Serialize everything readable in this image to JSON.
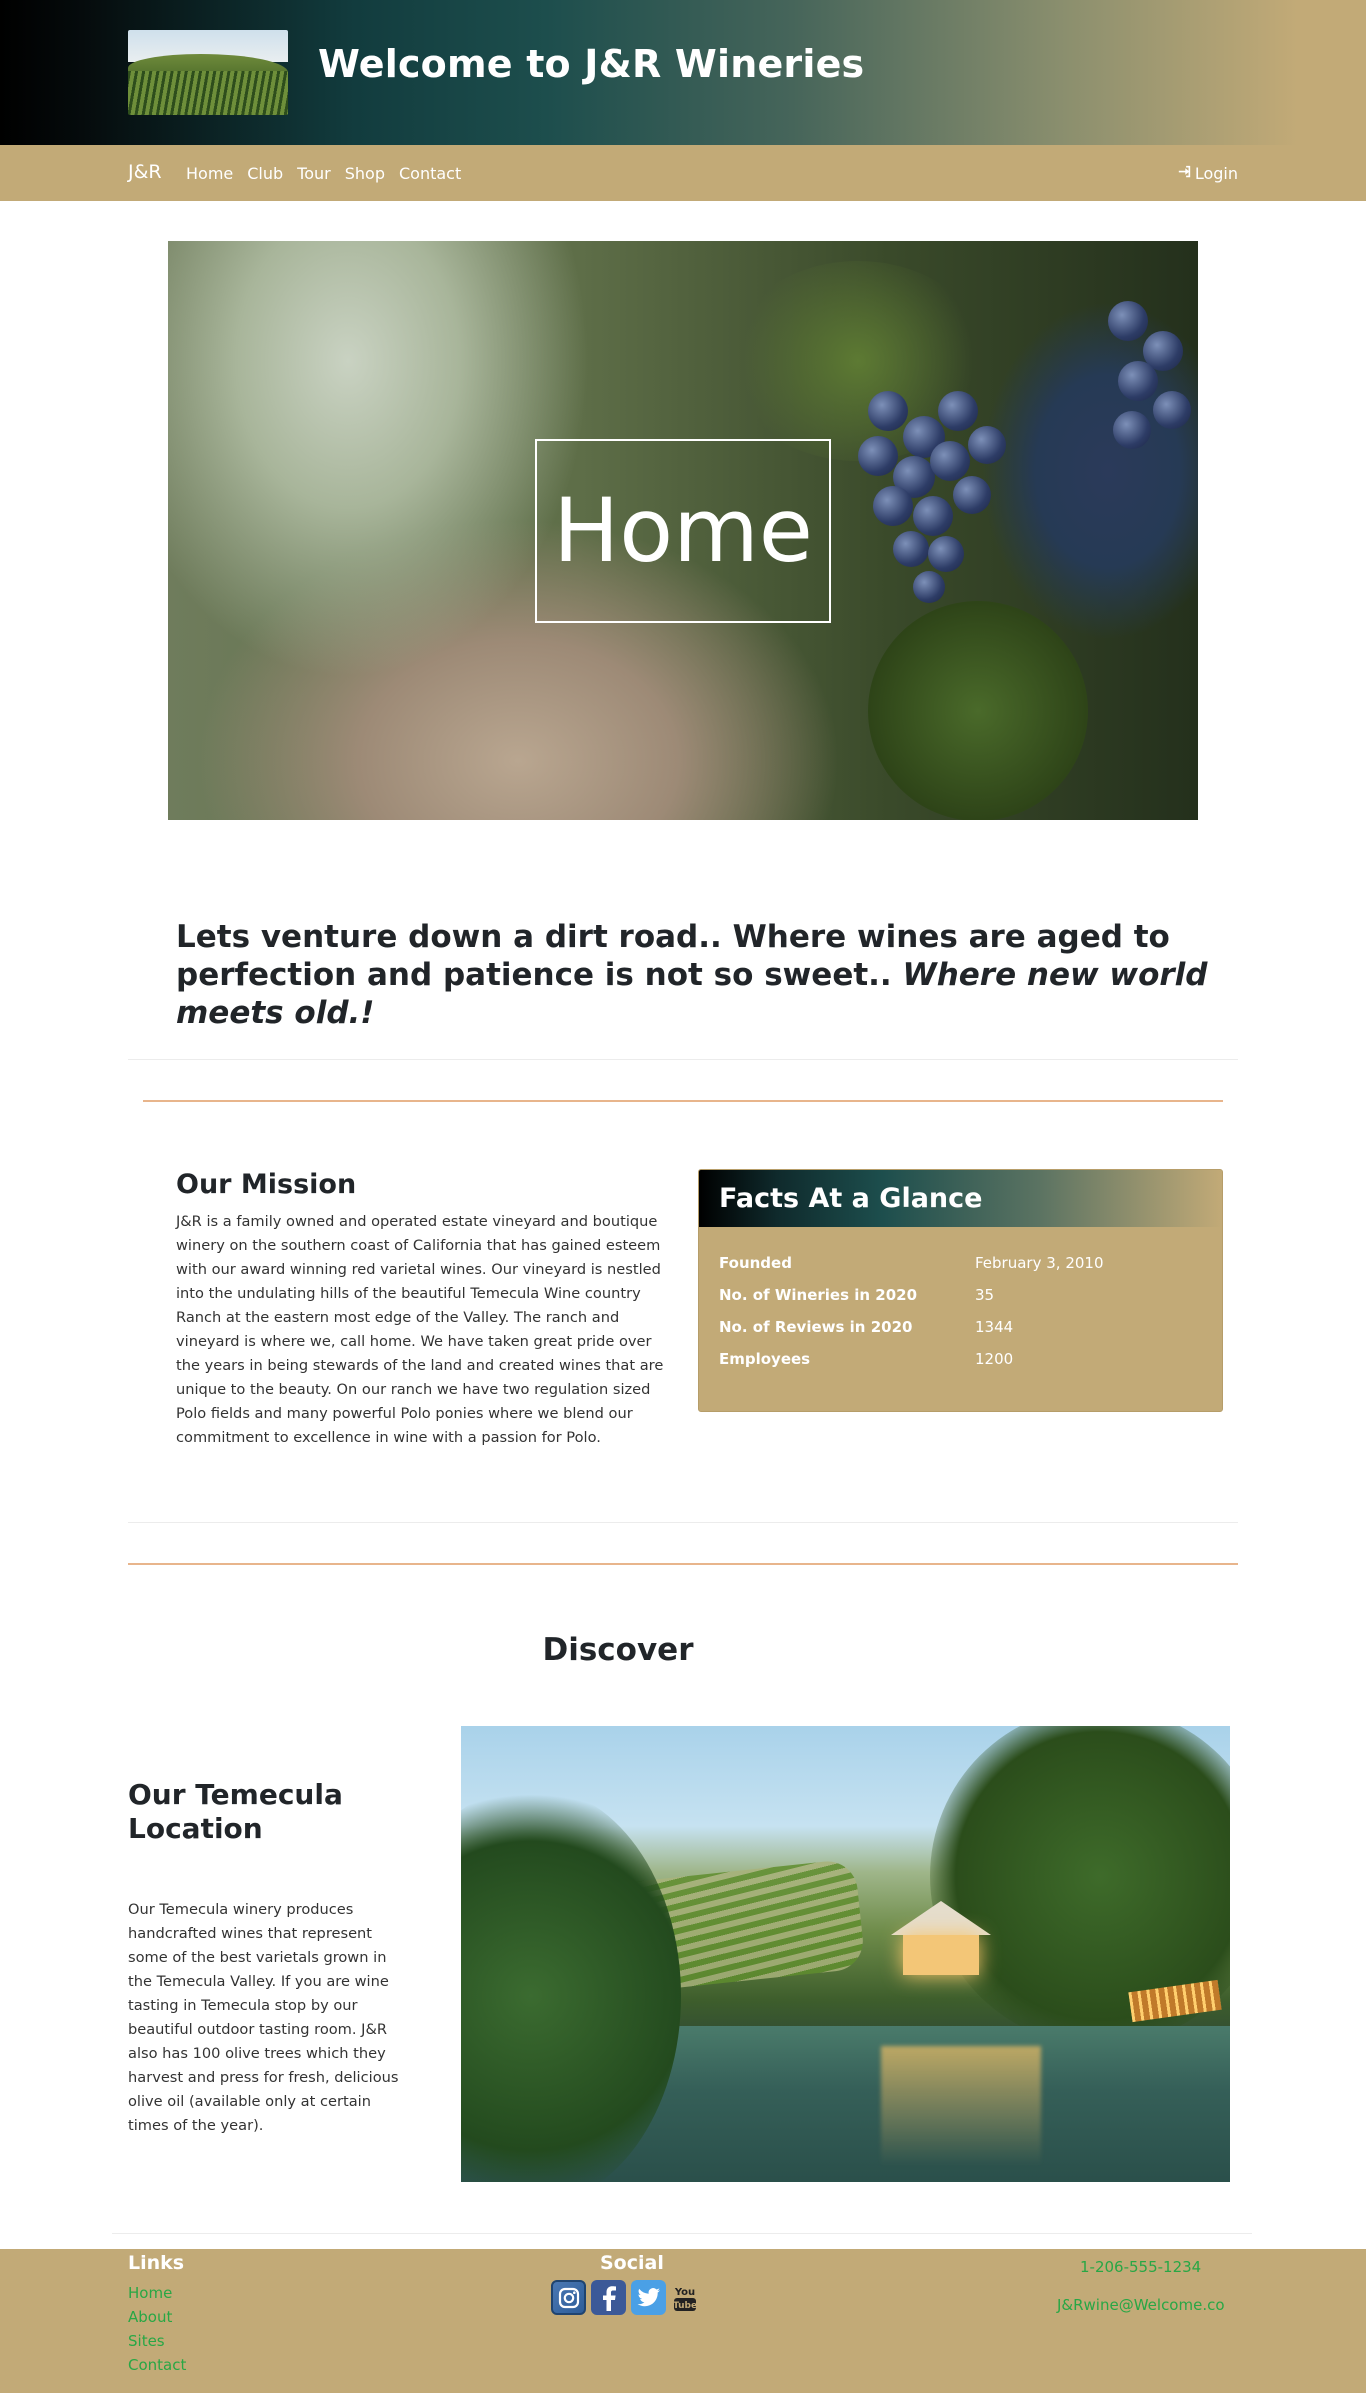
{
  "header": {
    "title": "Welcome to J&R Wineries",
    "logo_image": "vineyard-thumbnail"
  },
  "nav": {
    "brand": "J&R",
    "items": [
      {
        "label": "Home"
      },
      {
        "label": "Club"
      },
      {
        "label": "Tour"
      },
      {
        "label": "Shop"
      },
      {
        "label": "Contact"
      }
    ],
    "login_label": "Login",
    "login_icon": "sign-in-icon"
  },
  "hero": {
    "title": "Home"
  },
  "tagline": {
    "main": "Lets venture down a dirt road.. Where wines are aged to perfection and patience is not so sweet.. ",
    "italic": "Where new world meets old.!"
  },
  "mission": {
    "title": "Our Mission",
    "text": "J&R is a family owned and operated estate vineyard and boutique winery on the southern coast of California that has gained esteem with our award winning red varietal wines. Our vineyard is nestled into the undulating hills of the beautiful Temecula Wine country Ranch at the eastern most edge of the Valley. The ranch and vineyard is where we, call home. We have taken great pride over the years in being stewards of the land and created wines that are unique to the beauty. On our ranch we have two regulation sized Polo fields and many powerful Polo ponies where we blend our commitment to excellence in wine with a passion for Polo."
  },
  "facts": {
    "title": "Facts At a Glance",
    "rows": [
      {
        "label": "Founded",
        "value": "February 3, 2010"
      },
      {
        "label": "No. of Wineries in 2020",
        "value": "35"
      },
      {
        "label": "No. of Reviews in 2020",
        "value": "1344"
      },
      {
        "label": "Employees",
        "value": "1200"
      }
    ]
  },
  "discover": {
    "title": "Discover",
    "location_title": "Our Temecula Location",
    "location_text": "Our Temecula winery produces handcrafted wines that represent some of the best varietals grown in the Temecula Valley. If you are wine tasting in Temecula stop by our beautiful outdoor tasting room. J&R also has 100 olive trees which they harvest and press for fresh, delicious olive oil (available only at certain times of the year)."
  },
  "footer": {
    "links_title": "Links",
    "links": [
      {
        "label": "Home"
      },
      {
        "label": "About"
      },
      {
        "label": "Sites"
      },
      {
        "label": "Contact"
      }
    ],
    "social_title": "Social",
    "social_icons": [
      "instagram-icon",
      "facebook-icon",
      "twitter-icon",
      "youtube-icon"
    ],
    "youtube_text": "You Tube",
    "phone": "1-206-555-1234",
    "email": "J&Rwine@Welcome.co"
  },
  "colors": {
    "gold": "#c2aa77",
    "teal": "#1d4e4d",
    "link_green": "#28a745",
    "rule_orange": "#e8b58c"
  }
}
